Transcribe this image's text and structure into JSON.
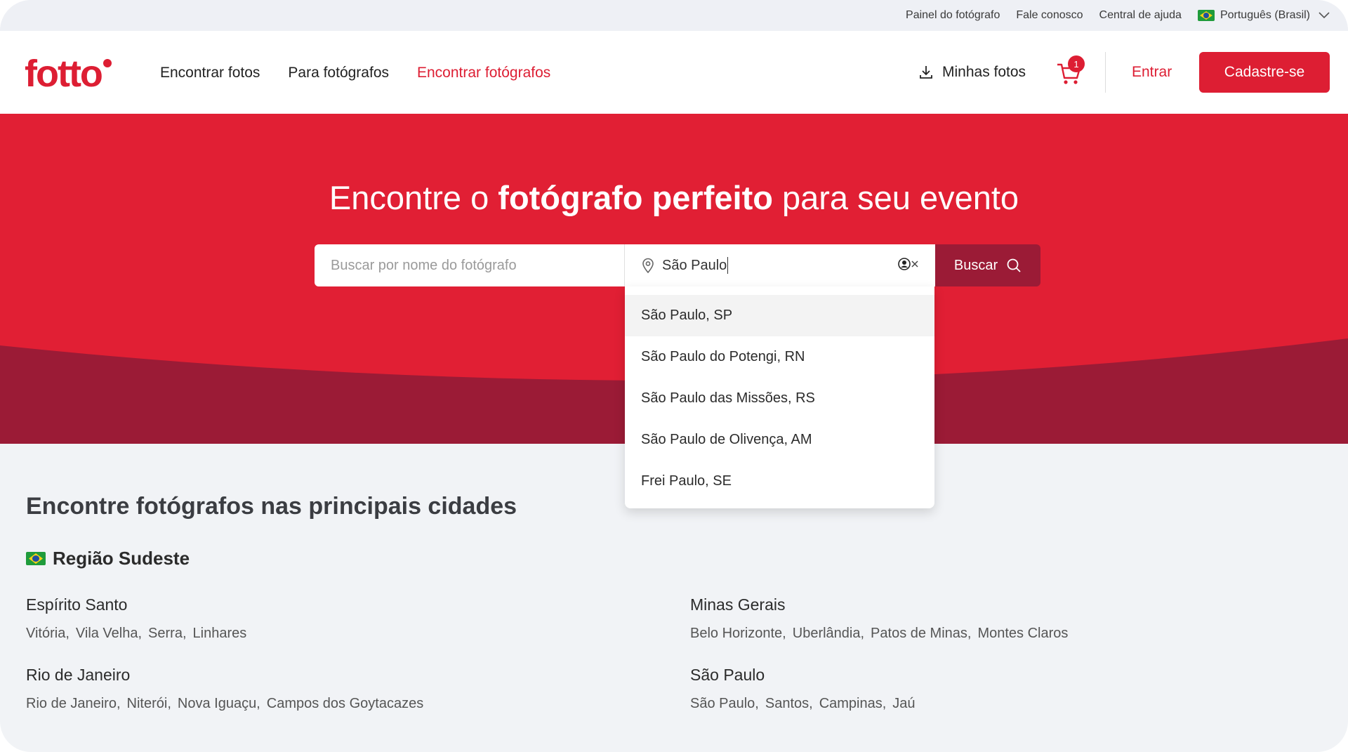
{
  "utility_bar": {
    "links": [
      "Painel do fotógrafo",
      "Fale conosco",
      "Central de ajuda"
    ],
    "language": "Português (Brasil)"
  },
  "header": {
    "logo": "fotto",
    "nav": [
      "Encontrar fotos",
      "Para fotógrafos",
      "Encontrar fotógrafos"
    ],
    "active_nav": "Encontrar fotógrafos",
    "my_photos": "Minhas fotos",
    "cart_count": "1",
    "login": "Entrar",
    "signup": "Cadastre-se"
  },
  "hero": {
    "title_pre": "Encontre o ",
    "title_bold": "fotógrafo perfeito",
    "title_post": " para seu evento"
  },
  "search": {
    "name_placeholder": "Buscar por nome do fotógrafo",
    "location_value": "São Paulo",
    "button": "Buscar"
  },
  "suggestions": [
    "São Paulo, SP",
    "São Paulo do Potengi, RN",
    "São Paulo das Missões, RS",
    "São Paulo de Olivença, AM",
    "Frei Paulo, SE"
  ],
  "main": {
    "title": "Encontre fotógrafos nas principais cidades",
    "region": "Região Sudeste",
    "states": [
      {
        "name": "Espírito Santo",
        "cities": [
          "Vitória,",
          "Vila Velha,",
          "Serra,",
          "Linhares"
        ]
      },
      {
        "name": "Minas Gerais",
        "cities": [
          "Belo Horizonte,",
          "Uberlândia,",
          "Patos de Minas,",
          "Montes Claros"
        ]
      },
      {
        "name": "Rio de Janeiro",
        "cities": [
          "Rio de Janeiro,",
          "Niterói,",
          "Nova Iguaçu,",
          "Campos dos Goytacazes"
        ]
      },
      {
        "name": "São Paulo",
        "cities": [
          "São Paulo,",
          "Santos,",
          "Campinas,",
          "Jaú"
        ]
      }
    ]
  },
  "colors": {
    "brand": "#dd1e33",
    "hero_dark": "#9b1b36",
    "background": "#f1f3f6"
  }
}
